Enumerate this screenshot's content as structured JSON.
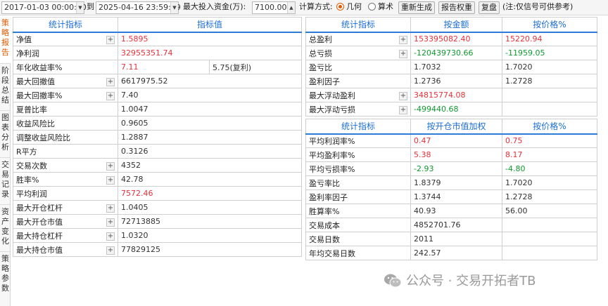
{
  "toolbar": {
    "start_date": "2017-01-03 00:00:00",
    "to_label": "到",
    "end_date": "2025-04-16 23:59:59",
    "max_capital_label": "最大投入资金(万):",
    "max_capital_value": "7100.00",
    "calc_method_label": "计算方式:",
    "calc_options": [
      {
        "label": "几何",
        "selected": true
      },
      {
        "label": "算术",
        "selected": false
      }
    ],
    "regenerate_label": "重新生成",
    "report_weight_label": "报告权重",
    "replay_label": "复盘",
    "note": "(注:仅信号可供参考)"
  },
  "sidebar": {
    "tabs": [
      {
        "label": "策略报告",
        "chars": [
          "策",
          "略",
          "报",
          "告"
        ],
        "active": true
      },
      {
        "label": "阶段总结",
        "chars": [
          "阶",
          "段",
          "总",
          "结"
        ],
        "active": false
      },
      {
        "label": "图表分析",
        "chars": [
          "图",
          "表",
          "分",
          "析"
        ],
        "active": false
      },
      {
        "label": "交易记录",
        "chars": [
          "交",
          "易",
          "记",
          "录"
        ],
        "active": false
      },
      {
        "label": "资产变化",
        "chars": [
          "资",
          "产",
          "变",
          "化"
        ],
        "active": false
      },
      {
        "label": "策略参数",
        "chars": [
          "策",
          "略",
          "参",
          "数"
        ],
        "active": false
      }
    ]
  },
  "left_table": {
    "header": {
      "metric": "统计指标",
      "value": "指标值"
    },
    "rows": [
      {
        "label": "净值",
        "plus": true,
        "value": "1.5895",
        "color": "red"
      },
      {
        "label": "净利润",
        "plus": false,
        "value": "32955351.74",
        "color": "red"
      },
      {
        "label": "年化收益率%",
        "plus": false,
        "value": "7.11",
        "color": "red",
        "extra": "5.75(复利)"
      },
      {
        "label": "最大回撤值",
        "plus": true,
        "value": "6617975.52",
        "color": "gray"
      },
      {
        "label": "最大回撤率%",
        "plus": true,
        "value": "7.40",
        "color": "gray"
      },
      {
        "label": "夏普比率",
        "plus": false,
        "value": "1.0047",
        "color": "gray"
      },
      {
        "label": "收益风险比",
        "plus": false,
        "value": "0.9605",
        "color": "gray"
      },
      {
        "label": "调整收益风险比",
        "plus": false,
        "value": "1.2887",
        "color": "gray"
      },
      {
        "label": "R平方",
        "plus": false,
        "value": "0.3126",
        "color": "gray"
      },
      {
        "label": "交易次数",
        "plus": true,
        "value": "4352",
        "color": "gray"
      },
      {
        "label": "胜率%",
        "plus": true,
        "value": "42.78",
        "color": "gray"
      },
      {
        "label": "平均利润",
        "plus": false,
        "value": "7572.46",
        "color": "red"
      },
      {
        "label": "最大开仓杠杆",
        "plus": true,
        "value": "1.0405",
        "color": "gray"
      },
      {
        "label": "最大开仓市值",
        "plus": true,
        "value": "72713885",
        "color": "gray"
      },
      {
        "label": "最大持仓杠杆",
        "plus": true,
        "value": "1.0320",
        "color": "gray"
      },
      {
        "label": "最大持仓市值",
        "plus": true,
        "value": "77829125",
        "color": "gray"
      }
    ]
  },
  "right_table_1": {
    "header": {
      "metric": "统计指标",
      "by_amount": "按金额",
      "by_price": "按价格%"
    },
    "rows": [
      {
        "label": "总盈利",
        "plus": true,
        "amount": "153395082.40",
        "amount_color": "red",
        "price": "15220.94",
        "price_color": "red"
      },
      {
        "label": "总亏损",
        "plus": true,
        "amount": "-120439730.66",
        "amount_color": "green",
        "price": "-11959.05",
        "price_color": "green"
      },
      {
        "label": "盈亏比",
        "plus": false,
        "amount": "1.7032",
        "amount_color": "gray",
        "price": "1.7020",
        "price_color": "gray"
      },
      {
        "label": "盈利因子",
        "plus": false,
        "amount": "1.2736",
        "amount_color": "gray",
        "price": "1.2728",
        "price_color": "gray"
      },
      {
        "label": "最大浮动盈利",
        "plus": true,
        "amount": "34815774.08",
        "amount_color": "red",
        "price": "",
        "price_color": "gray"
      },
      {
        "label": "最大浮动亏损",
        "plus": true,
        "amount": "-499440.68",
        "amount_color": "green",
        "price": "",
        "price_color": "gray"
      }
    ]
  },
  "right_table_2": {
    "header": {
      "metric": "统计指标",
      "by_weight": "按开仓市值加权",
      "by_price": "按价格%"
    },
    "rows": [
      {
        "label": "平均利润率%",
        "weighted": "0.47",
        "weighted_color": "red",
        "price": "0.75",
        "price_color": "red"
      },
      {
        "label": "平均盈利率%",
        "weighted": "5.38",
        "weighted_color": "red",
        "price": "8.17",
        "price_color": "red"
      },
      {
        "label": "平均亏损率%",
        "weighted": "-2.93",
        "weighted_color": "green",
        "price": "-4.80",
        "price_color": "green"
      },
      {
        "label": "盈亏率比",
        "weighted": "1.8379",
        "weighted_color": "gray",
        "price": "1.7020",
        "price_color": "gray"
      },
      {
        "label": "盈利率因子",
        "weighted": "1.3744",
        "weighted_color": "gray",
        "price": "1.2728",
        "price_color": "gray"
      },
      {
        "label": "胜算率%",
        "weighted": "40.93",
        "weighted_color": "gray",
        "price": "56.00",
        "price_color": "gray"
      },
      {
        "label": "交易成本",
        "weighted": "4852701.76",
        "weighted_color": "gray",
        "price": "",
        "price_color": "gray"
      },
      {
        "label": "交易日数",
        "weighted": "2011",
        "weighted_color": "gray",
        "price": "",
        "price_color": "gray"
      },
      {
        "label": "年均交易日数",
        "weighted": "242.57",
        "weighted_color": "gray",
        "price": "",
        "price_color": "gray"
      }
    ]
  },
  "watermark": {
    "text": "公众号 · 交易开拓者TB",
    "icon": "wechat-icon"
  }
}
